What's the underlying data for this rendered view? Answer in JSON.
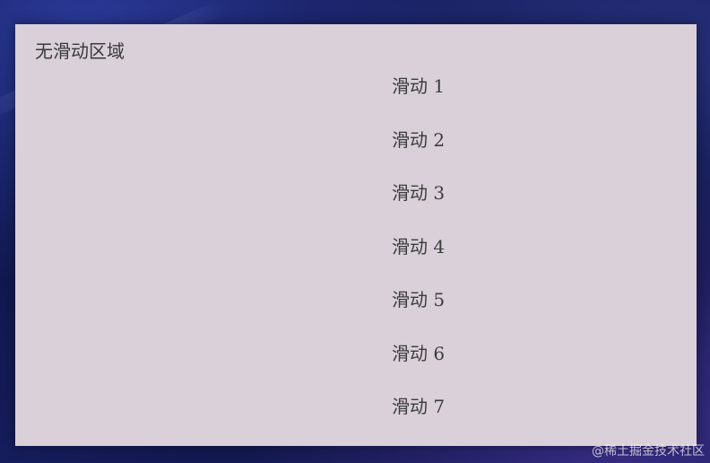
{
  "panel": {
    "static_label": "无滑动区域",
    "scroll_items": [
      "滑动 1",
      "滑动 2",
      "滑动 3",
      "滑动 4",
      "滑动 5",
      "滑动 6",
      "滑动 7"
    ]
  },
  "watermark": "@稀土掘金技术社区",
  "colors": {
    "panel_background": "#d9d0d9",
    "text": "#3a3a3a",
    "desktop_background": "#161d5c"
  }
}
